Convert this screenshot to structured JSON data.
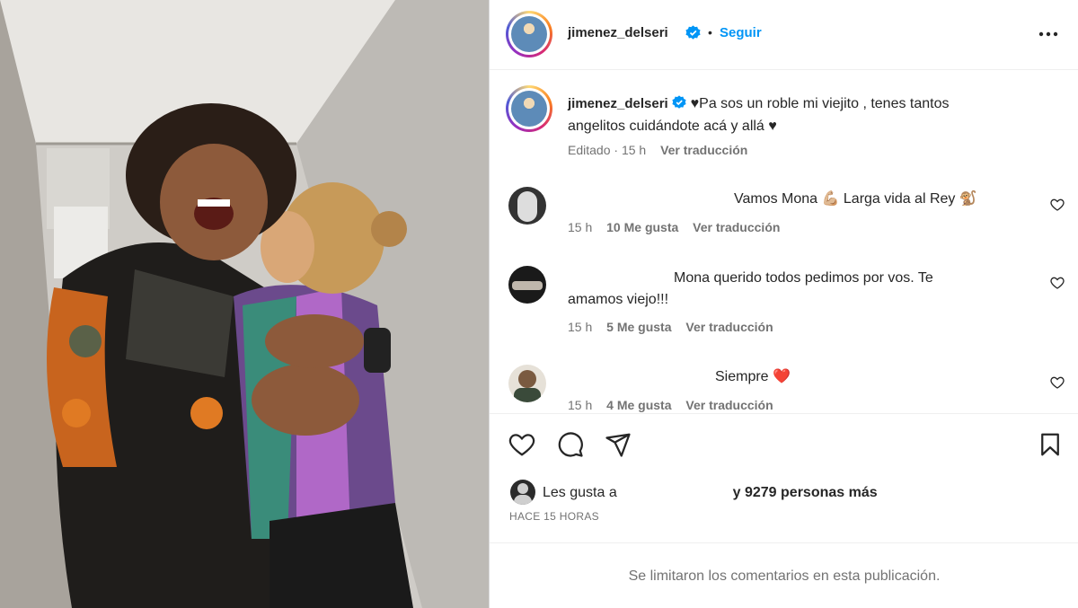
{
  "header": {
    "username": "jimenez_delseri",
    "dot": "•",
    "follow_label": "Seguir",
    "more_icon": "more-horizontal-icon"
  },
  "caption": {
    "username": "jimenez_delseri",
    "text_line1": "♥Pa sos un roble mi viejito , tenes tantos",
    "text_line2": "angelitos cuidándote acá y allá ♥",
    "edited": "Editado",
    "time": "15 h",
    "translate": "Ver traducción"
  },
  "comments": [
    {
      "text": "Vamos Mona 💪🏼 Larga vida al Rey 🐒",
      "time": "15 h",
      "likes": "10 Me gusta",
      "translate": "Ver traducción"
    },
    {
      "text_line1": "Mona querido todos pedimos por vos. Te",
      "text_line2": "amamos viejo!!!",
      "time": "15 h",
      "likes": "5 Me gusta",
      "translate": "Ver traducción"
    },
    {
      "text": "Siempre ❤️",
      "time": "15 h",
      "likes": "4 Me gusta",
      "translate": "Ver traducción"
    }
  ],
  "likes": {
    "prefix": "Les gusta a",
    "suffix": "y 9279 personas más",
    "time_label": "HACE 15 HORAS"
  },
  "footer": {
    "limited_text": "Se limitaron los comentarios en esta publicación."
  },
  "colors": {
    "accent": "#0095f6",
    "text": "#262626",
    "muted": "#737373",
    "heart_red": "#ed4956"
  }
}
